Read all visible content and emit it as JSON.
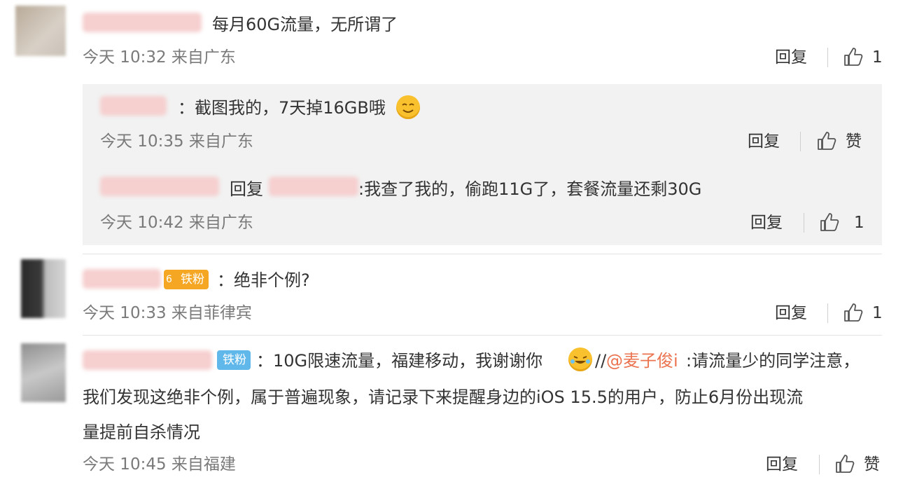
{
  "comments": [
    {
      "text": "每月60G流量，无所谓了",
      "meta": "今天 10:32 来自广东",
      "reply_label": "回复",
      "likes": "1",
      "replies": [
        {
          "text_prefix": "：截图我的，7天掉16GB哦",
          "meta": "今天 10:35 来自广东",
          "reply_label": "回复",
          "likes": "赞"
        },
        {
          "reply_prefix": "回复",
          "text": ":我查了我的，偷跑11G了，套餐流量还剩30G",
          "meta": "今天 10:42 来自广东",
          "reply_label": "回复",
          "likes": "1"
        }
      ]
    },
    {
      "badge": "铁粉",
      "badge_level": "6",
      "text": "：绝非个例?",
      "meta": "今天 10:33 来自菲律宾",
      "reply_label": "回复",
      "likes": "1"
    },
    {
      "badge": "铁粉",
      "text_a": "：10G限速流量，福建移动，我谢谢你",
      "text_b": "//",
      "mention": "@麦子俊i",
      "text_c": ":请流量少的同学注意，",
      "line2": "我们发现这绝非个例，属于普遍现象，请记录下来提醒身边的iOS 15.5的用户，防止6月份出现流",
      "line3": "量提前自杀情况",
      "meta": "今天 10:45 来自福建",
      "reply_label": "回复",
      "likes": "赞"
    }
  ],
  "colors": {
    "mention": "#eb7350",
    "badge_orange": "#f5a623",
    "badge_blue": "#5fb7ea",
    "subbox": "#f2f2f2"
  }
}
